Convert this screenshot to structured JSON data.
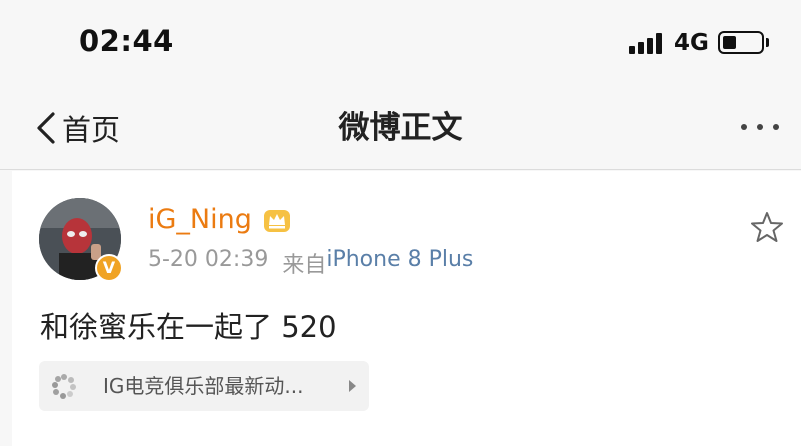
{
  "status_bar": {
    "time": "02:44",
    "network": "4G",
    "signal_bars": 4,
    "battery_level": 0.35
  },
  "nav": {
    "back_label": "首页",
    "title": "微博正文"
  },
  "post": {
    "username": "iG_Ning",
    "verified_badge": "V",
    "date_time": "5-20 02:39",
    "source_prefix": "来自",
    "source_device": "iPhone 8 Plus",
    "text": "和徐蜜乐在一起了 520",
    "link_label": "IG电竞俱乐部最新动..."
  },
  "colors": {
    "username": "#eb7b11",
    "device_link": "#5a7fa8",
    "badge": "#f0a324"
  }
}
